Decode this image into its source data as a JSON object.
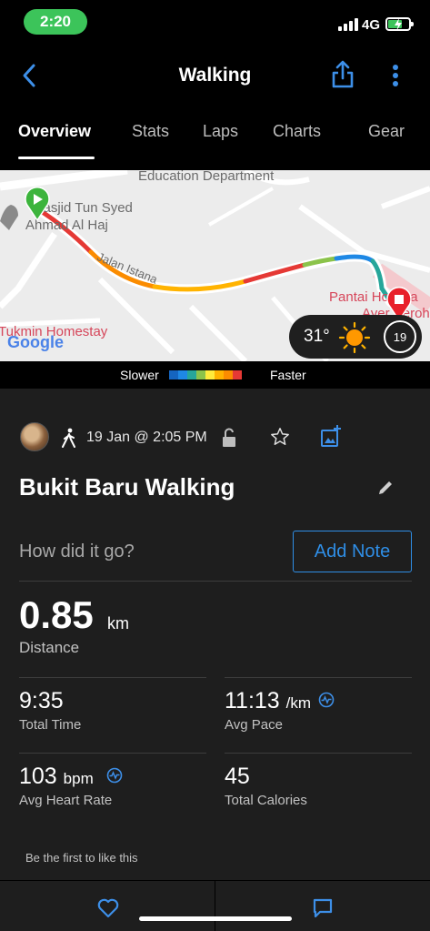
{
  "status_bar": {
    "time": "2:20",
    "network": "4G"
  },
  "nav": {
    "title": "Walking"
  },
  "tabs": [
    "Overview",
    "Stats",
    "Laps",
    "Charts",
    "Gear"
  ],
  "map": {
    "labels": {
      "education": "Education Department",
      "masjid_line1": "Masjid Tun Syed",
      "masjid_line2": "Ahmad Al Haj",
      "street": "Jalan Istana",
      "hospital_line1": "Pantai Hospita",
      "hospital_line2": "Ayer Keroh",
      "homestay": "Tukmin Homestay",
      "google": "Google"
    },
    "weather": {
      "temperature": "31°",
      "badge": "19"
    }
  },
  "legend": {
    "slower": "Slower",
    "faster": "Faster",
    "colors": [
      "#1565c0",
      "#1e88e5",
      "#26a69a",
      "#8bc34a",
      "#ffeb3b",
      "#ffb300",
      "#fb8c00",
      "#e53935"
    ]
  },
  "activity": {
    "date": "19 Jan @ 2:05 PM",
    "title": "Bukit Baru Walking",
    "note_prompt": "How did it go?",
    "note_button": "Add Note"
  },
  "stats": {
    "distance": {
      "value": "0.85",
      "unit": "km",
      "label": "Distance"
    },
    "total_time": {
      "value": "9:35",
      "label": "Total Time"
    },
    "avg_pace": {
      "value": "11:13",
      "unit": "/km",
      "label": "Avg Pace"
    },
    "avg_hr": {
      "value": "103",
      "unit": "bpm",
      "label": "Avg Heart Rate"
    },
    "calories": {
      "value": "45",
      "label": "Total Calories"
    }
  },
  "social": {
    "likes_text": "Be the first to like this"
  },
  "colors": {
    "accent": "#2f8ee6",
    "start_marker": "#3cb43c",
    "end_marker": "#e8202a",
    "time_pill": "#3cc45a"
  }
}
